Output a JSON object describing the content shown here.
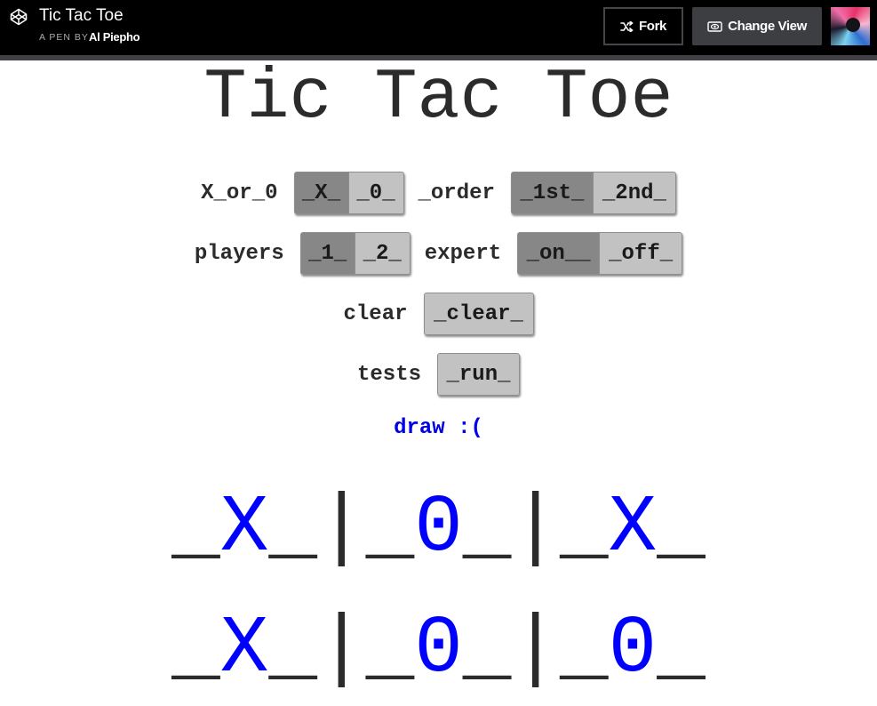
{
  "header": {
    "pen_title": "Tic Tac Toe",
    "pen_by": "A PEN BY",
    "author": "Al Piepho",
    "fork_label": "Fork",
    "change_view_label": "Change View"
  },
  "title": "Tic Tac Toe",
  "controls": {
    "symbol": {
      "label": "X_or_0",
      "options": [
        "_X_",
        "_0_"
      ],
      "selected": 0
    },
    "order": {
      "label": "_order",
      "options": [
        "_1st_",
        "_2nd_"
      ],
      "selected": 0
    },
    "players": {
      "label": "players",
      "options": [
        "_1_",
        "_2_"
      ],
      "selected": 0
    },
    "expert": {
      "label": "expert",
      "options": [
        "_on__",
        "_off_"
      ],
      "selected": 0
    },
    "clear": {
      "label": "clear",
      "button": "_clear_"
    },
    "tests": {
      "label": "tests",
      "button": "_run_"
    }
  },
  "status": "draw :(",
  "board": {
    "row1": [
      "X",
      "0",
      "X"
    ],
    "row2": [
      "X",
      "0",
      "0"
    ]
  },
  "colors": {
    "mark": "#0000ff",
    "status": "#0000e6",
    "toggle_selected": "#878787",
    "toggle_unselected": "#c2c2c2"
  }
}
